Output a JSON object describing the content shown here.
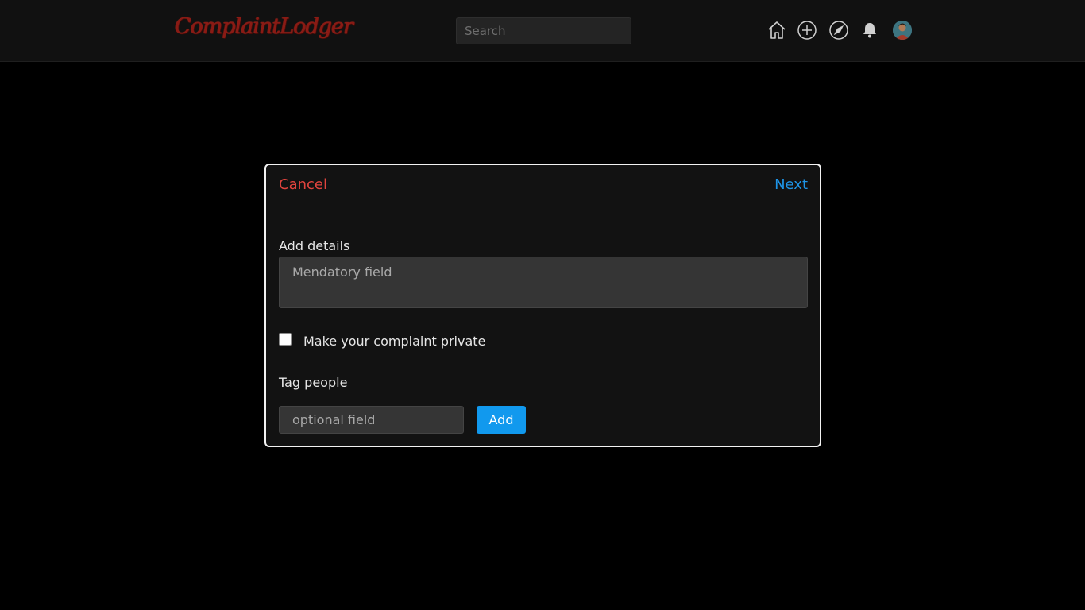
{
  "header": {
    "logo_text": "ComplaintLodger",
    "search": {
      "placeholder": "Search",
      "value": ""
    },
    "icons": [
      "home-icon",
      "add-circle-icon",
      "compass-icon",
      "bell-icon",
      "avatar"
    ],
    "colors": {
      "background": "#111111",
      "logo": "#8a1a14"
    }
  },
  "modal": {
    "cancel_label": "Cancel",
    "next_label": "Next",
    "details_label": "Add details",
    "details_placeholder": "Mendatory field",
    "details_value": "",
    "private_checkbox": {
      "label": "Make your complaint private",
      "checked": false
    },
    "tag_label": "Tag people",
    "tag_placeholder": "optional field",
    "tag_value": "",
    "add_label": "Add",
    "colors": {
      "cancel": "#e0443e",
      "next": "#1e94e6",
      "add_button": "#1199ee"
    }
  }
}
